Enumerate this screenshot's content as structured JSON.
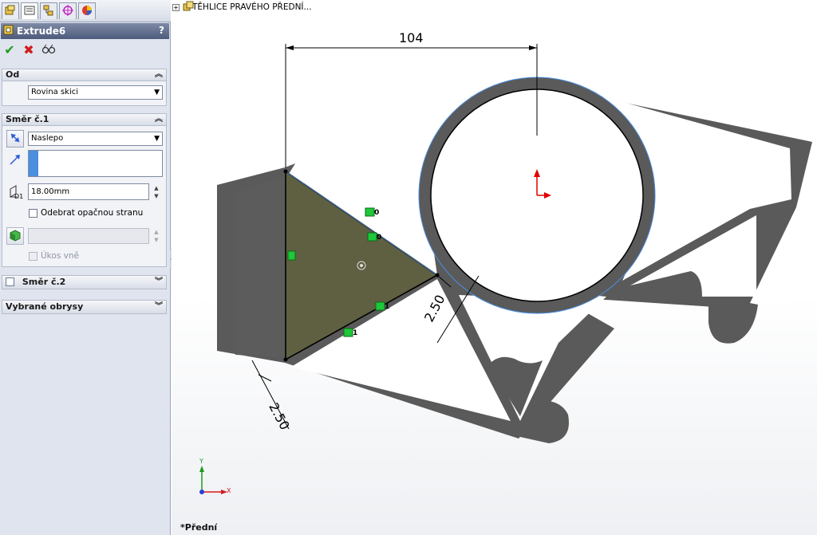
{
  "pm": {
    "title": "Extrude6",
    "help": "?",
    "groups": {
      "od": {
        "label": "Od",
        "from_value": "Rovina skici"
      },
      "smer1": {
        "label": "Směr č.1",
        "end_condition": "Naslepo",
        "depth": "18.00mm",
        "depth_icon_label": "D1",
        "flip_side_label": "Odebrat opačnou stranu",
        "draft_outward_label": "Úkos vně"
      },
      "smer2": {
        "label": "Směr č.2"
      },
      "obrysy": {
        "label": "Vybrané obrysy"
      }
    }
  },
  "tree": {
    "node_label": "TĚHLICE PRAVÉHO PŘEDNÍ..."
  },
  "viewport": {
    "dimensions": {
      "width": "104",
      "thickness_a": "2.50",
      "thickness_b": "2.50"
    },
    "relation_tags": [
      "0",
      "0",
      "1",
      "1"
    ],
    "view_label": "*Přední",
    "triad": {
      "x": "X",
      "y": "Y"
    }
  },
  "colors": {
    "part_fill": "#5a5a5a",
    "selected_region": "#5f5f42",
    "accent_blue": "#4a8fe0",
    "dimension_line": "#000000",
    "relation_green": "#1ec83a",
    "origin_red": "#e00000"
  }
}
